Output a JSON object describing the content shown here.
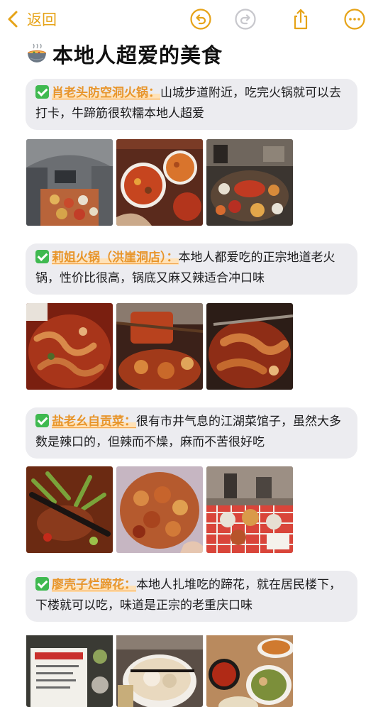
{
  "toolbar": {
    "back_label": "返回",
    "icons": [
      "undo-icon",
      "redo-icon",
      "share-icon",
      "more-icon"
    ],
    "accent": "#e6a317"
  },
  "note": {
    "title": "本地人超爱的美食",
    "title_icon": "hotpot-bowl-icon",
    "sections": [
      {
        "name": "肖老头防空洞火锅：",
        "desc": "山城步道附近，吃完火锅就可以去打卡，牛蹄筋很软糯本地人超爱",
        "photos": [
          "bomb-shelter-hotpot-restaurant-photo",
          "hotpot-dishes-photo",
          "hotpot-table-photo"
        ]
      },
      {
        "name": "莉姐火锅（洪崖洞店）：",
        "desc": "本地人都爱吃的正宗地道老火锅，性价比很高，锅底又麻又辣适合冲口味",
        "photos": [
          "spicy-hotpot-closeup-photo",
          "chopsticks-tripe-photo",
          "braised-meat-pot-photo"
        ]
      },
      {
        "name": "盐老幺自贡菜：",
        "desc": "很有市井气息的江湖菜馆子，虽然大多数是辣口的，但辣而不燥，麻而不苦很好吃",
        "photos": [
          "rabbit-with-peppers-photo",
          "spicy-chicken-bowl-photo",
          "restaurant-dining-table-photo"
        ]
      },
      {
        "name": "廖壳子烂蹄花：",
        "desc": "本地人扎堆吃的蹄花，就在居民楼下，下楼就可以吃，味道是正宗的老重庆口味",
        "photos": [
          "menu-board-photo",
          "trotter-soup-photo",
          "table-of-dishes-photo"
        ]
      }
    ]
  },
  "colors": {
    "card_bg": "#ececf0",
    "name_color": "#e8952a",
    "check_green": "#3fb950"
  }
}
